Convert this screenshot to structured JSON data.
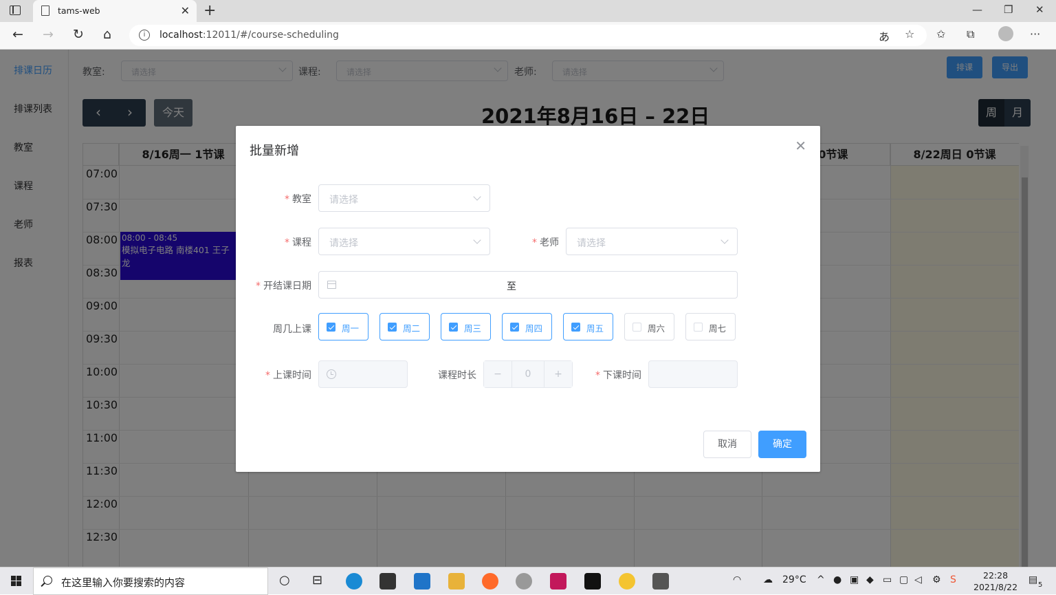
{
  "browser": {
    "tab_title": "tams-web",
    "url_host": "localhost",
    "url_rest": ":12011/#/course-scheduling"
  },
  "sidebar": {
    "items": [
      {
        "label": "排课日历",
        "active": true
      },
      {
        "label": "排课列表"
      },
      {
        "label": "教室"
      },
      {
        "label": "课程"
      },
      {
        "label": "老师"
      },
      {
        "label": "报表"
      }
    ]
  },
  "filters": {
    "classroom_label": "教室:",
    "course_label": "课程:",
    "teacher_label": "老师:",
    "placeholder": "请选择",
    "schedule_button": "排课",
    "export_button": "导出"
  },
  "calendar": {
    "prev": "‹",
    "next": "›",
    "today": "今天",
    "title": "2021年8月16日 – 22日",
    "view_week": "周",
    "view_month": "月",
    "headers": [
      "8/16周一  1节课",
      "",
      "",
      "",
      "",
      "六  0节课",
      "8/22周日  0节课"
    ],
    "times": [
      "07:00",
      "07:30",
      "08:00",
      "08:30",
      "09:00",
      "09:30",
      "10:00",
      "10:30",
      "11:00",
      "11:30",
      "12:00",
      "12:30"
    ],
    "event": {
      "time": "08:00 - 08:45",
      "title": "模拟电子电路 南楼401 王子龙"
    }
  },
  "dialog": {
    "title": "批量新增",
    "classroom_label": "教室",
    "course_label": "课程",
    "teacher_label": "老师",
    "date_label": "开结课日期",
    "range_sep": "至",
    "weekday_label": "周几上课",
    "start_time_label": "上课时间",
    "duration_label": "课程时长",
    "end_time_label": "下课时间",
    "placeholder": "请选择",
    "weekdays": [
      {
        "label": "周一",
        "checked": true
      },
      {
        "label": "周二",
        "checked": true
      },
      {
        "label": "周三",
        "checked": true
      },
      {
        "label": "周四",
        "checked": true
      },
      {
        "label": "周五",
        "checked": true
      },
      {
        "label": "周六",
        "checked": false
      },
      {
        "label": "周七",
        "checked": false
      }
    ],
    "duration_value": "0",
    "minus": "−",
    "plus": "+",
    "cancel": "取消",
    "confirm": "确定"
  },
  "taskbar": {
    "search_placeholder": "在这里输入你要搜索的内容",
    "weather": "29°C",
    "time": "22:28",
    "date": "2021/8/22",
    "notif_count": "5"
  }
}
